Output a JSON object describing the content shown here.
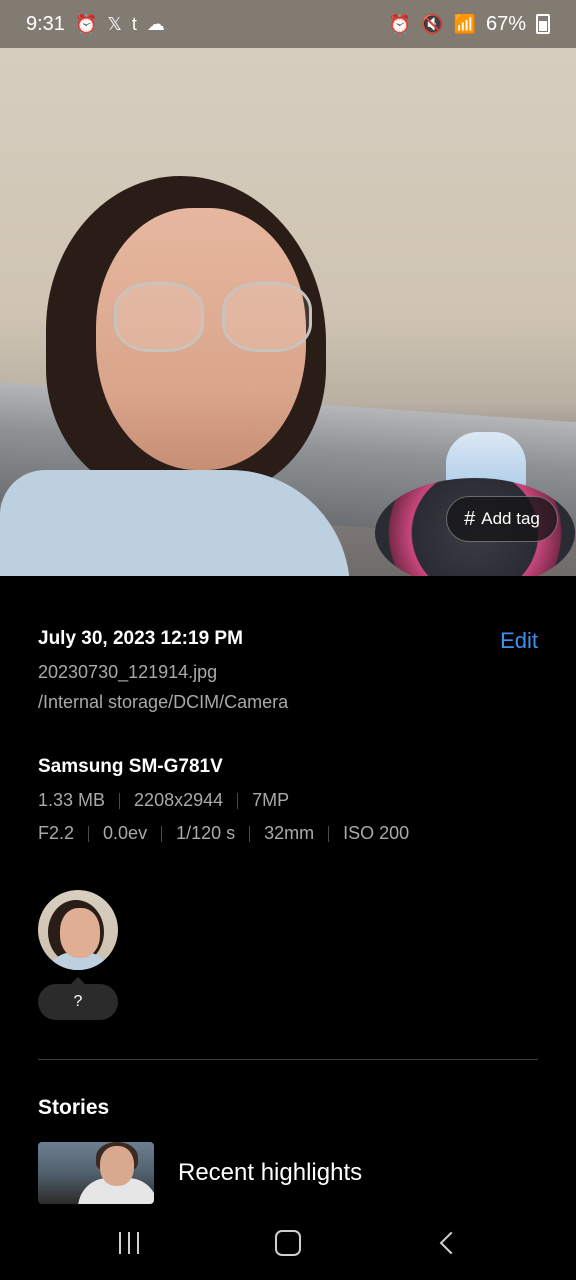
{
  "status_bar": {
    "time": "9:31",
    "battery": "67%",
    "left_icons": [
      "alarm-icon",
      "x-icon",
      "tumblr-icon",
      "cloud-icon"
    ],
    "right_icons": [
      "alarm-icon",
      "mute-icon",
      "wifi-icon",
      "signal-icon",
      "battery-icon"
    ]
  },
  "photo": {
    "add_tag_label": "Add tag",
    "add_tag_icon": "#"
  },
  "details": {
    "date": "July 30, 2023 12:19 PM",
    "edit_label": "Edit",
    "filename": "20230730_121914.jpg",
    "path": "/Internal storage/DCIM/Camera"
  },
  "device": {
    "name": "Samsung SM-G781V",
    "size": "1.33 MB",
    "resolution": "2208x2944",
    "megapixels": "7MP",
    "aperture": "F2.2",
    "exposure": "0.0ev",
    "shutter": "1/120 s",
    "focal_length": "32mm",
    "iso": "ISO 200"
  },
  "people": {
    "unknown_label": "?"
  },
  "stories": {
    "title": "Stories",
    "items": [
      {
        "label": "Recent highlights"
      }
    ]
  },
  "colors": {
    "accent": "#3e91f0",
    "background": "#000000",
    "secondary_text": "#a9a9a9"
  }
}
